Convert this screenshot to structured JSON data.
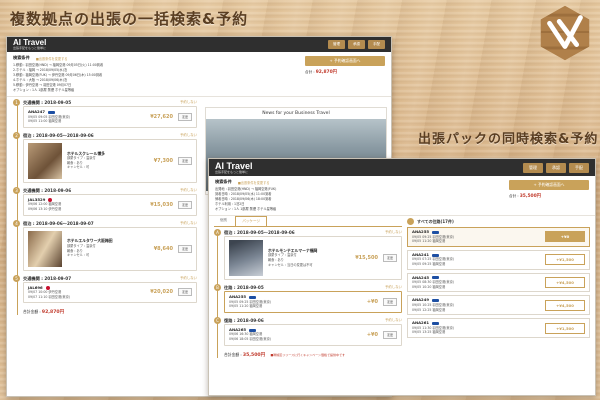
{
  "headline_left": "複数拠点の出張の一括検索&予約",
  "headline_right": "出張パックの同時検索&予約",
  "colors": {
    "brand_gold": "#c9a25a",
    "topbar": "#2f2f2f",
    "accent_red": "#c0392b"
  },
  "back": {
    "logo": "AI Travel",
    "logo_sub": "出張手配をもっと簡単に",
    "nav": [
      "管理",
      "承認",
      "手配"
    ],
    "cond_title": "検索条件",
    "cond_link": "■出張条件を変更する",
    "cond_lines": [
      "1.移動 : 羽田空港(HND) → 福岡空港 09月05日(火) 11:00到着",
      "2.ホテル : 福岡 → 2018/09/05(水)泊",
      "3.移動 : 福岡空港(FUK) → 伊丹空港 09月06日(木) 15:00到着",
      "4.ホテル : 大阪 → 2018/09/06(木)泊",
      "5.移動 : 伊丹空港 → 羽田空港 09月07日",
      "オプション : 1人 1部屋 禁煙 ホテル星等級"
    ],
    "reserve_btn": "+ 予約確認画面へ",
    "total_label": "合計 :",
    "total_value": "92,870円",
    "segments": [
      {
        "num": "1",
        "title": "交通機関 : 2018-09-05",
        "action": "予約しない",
        "name": "ANA247",
        "lines": [
          "09/05 09:05 羽田空港(東京)",
          "09/05 11:00 福岡空港"
        ],
        "price": "¥27,620",
        "btn": "変更"
      },
      {
        "num": "2",
        "title": "宿泊 : 2018-09-05〜2018-09-06",
        "action": "予約しない",
        "name": "ホテルスクレール博多",
        "lines": [
          "部屋タイプ : 温泉付",
          "朝食 : あり",
          "キャンセル : 可"
        ],
        "price": "¥7,300",
        "btn": "変更"
      },
      {
        "num": "3",
        "title": "交通機関 : 2018-09-06",
        "action": "予約しない",
        "name": "JAL3529",
        "lines": [
          "09/06 12:00 福岡空港",
          "09/06 13:10 伊丹空港"
        ],
        "price": "¥15,030",
        "btn": "変更"
      },
      {
        "num": "4",
        "title": "宿泊 : 2018-09-06〜2018-09-07",
        "action": "予約しない",
        "name": "ホテルエルタワー大阪梅田",
        "lines": [
          "部屋タイプ : 温泉付",
          "朝食 : あり",
          "キャンセル : 可"
        ],
        "price": "¥8,640",
        "btn": "変更"
      },
      {
        "num": "5",
        "title": "交通機関 : 2018-09-07",
        "action": "予約しない",
        "name": "JAL696",
        "lines": [
          "09/07 10:00 伊丹空港",
          "09/07 11:10 羽田空港(東京)"
        ],
        "price": "¥20,020",
        "btn": "変更"
      }
    ],
    "bottom_total_label": "合計金額 :",
    "bottom_total_value": "92,870円",
    "news_title": "News for your Business Travel"
  },
  "front": {
    "logo": "AI Travel",
    "logo_sub": "出張手配をもっと簡単に",
    "nav": [
      "管理",
      "承認",
      "手配"
    ],
    "cond_title": "検索条件",
    "cond_link": "■出張条件を変更する",
    "cond_lines": [
      "出発地 : 羽田空港(HND) → 福岡空港(FUK)",
      "到着日時 : 2018/09/05(水) 11:00到着",
      "帰着日時 : 2018/09/06(木) 18:00到着",
      "ホテル利用 : 1泊2日",
      "オプション : 1人 1部屋 禁煙 ホテル星等級"
    ],
    "reserve_btn": "+ 予約確認画面へ",
    "total_label": "合計 :",
    "total_value": "35,500円",
    "tabs": [
      "個別",
      "パッケージ"
    ],
    "segments": [
      {
        "num": "A",
        "title": "宿泊 : 2018-09-05〜2018-09-06",
        "action": "予約しない",
        "name": "ホテルモンテエルマーナ福岡",
        "lines": [
          "部屋タイプ : 温泉付",
          "朝食 : あり",
          "キャンセル : 当日の変更は不可"
        ],
        "price": "¥15,500",
        "btn": "変更"
      },
      {
        "num": "B",
        "title": "往路 : 2018-09-05",
        "action": "予約しない",
        "name": "ANA255",
        "lines": [
          "09/05 09:25 羽田空港(東京)",
          "09/05 11:20 福岡空港"
        ],
        "price": "+¥0",
        "btn": "変更"
      },
      {
        "num": "C",
        "title": "復路 : 2018-09-06",
        "action": "予約しない",
        "name": "ANA265",
        "lines": [
          "09/06 16:30 福岡空港",
          "09/06 18:05 羽田空港(東京)"
        ],
        "price": "+¥0",
        "btn": "変更"
      }
    ],
    "bottom_total_label": "合計金額 :",
    "bottom_total_value": "35,500円",
    "bottom_note": "■幹線区リリースに行くキャンペーン価格で提供中です",
    "list_head": "すべての往路(17件)",
    "flights": [
      {
        "name": "ANA255",
        "lines": [
          "09/05 09:25 羽田空港(東京)",
          "09/05 11:20 福岡空港"
        ],
        "price": "+¥0",
        "selected": true
      },
      {
        "name": "ANA241",
        "lines": [
          "09/05 07:25 羽田空港(東京)",
          "09/05 09:25 福岡空港"
        ],
        "price": "+¥1,500",
        "selected": false
      },
      {
        "name": "ANA245",
        "lines": [
          "09/05 08:30 羽田空港(東京)",
          "09/05 10:20 福岡空港"
        ],
        "price": "+¥4,500",
        "selected": false
      },
      {
        "name": "ANA249",
        "lines": [
          "09/05 10:25 羽田空港(東京)",
          "09/05 12:25 福岡空港"
        ],
        "price": "+¥4,500",
        "selected": false
      },
      {
        "name": "ANA261",
        "lines": [
          "09/05 11:30 羽田空港(東京)",
          "09/05 13:25 福岡空港"
        ],
        "price": "+¥1,500",
        "selected": false
      }
    ]
  }
}
